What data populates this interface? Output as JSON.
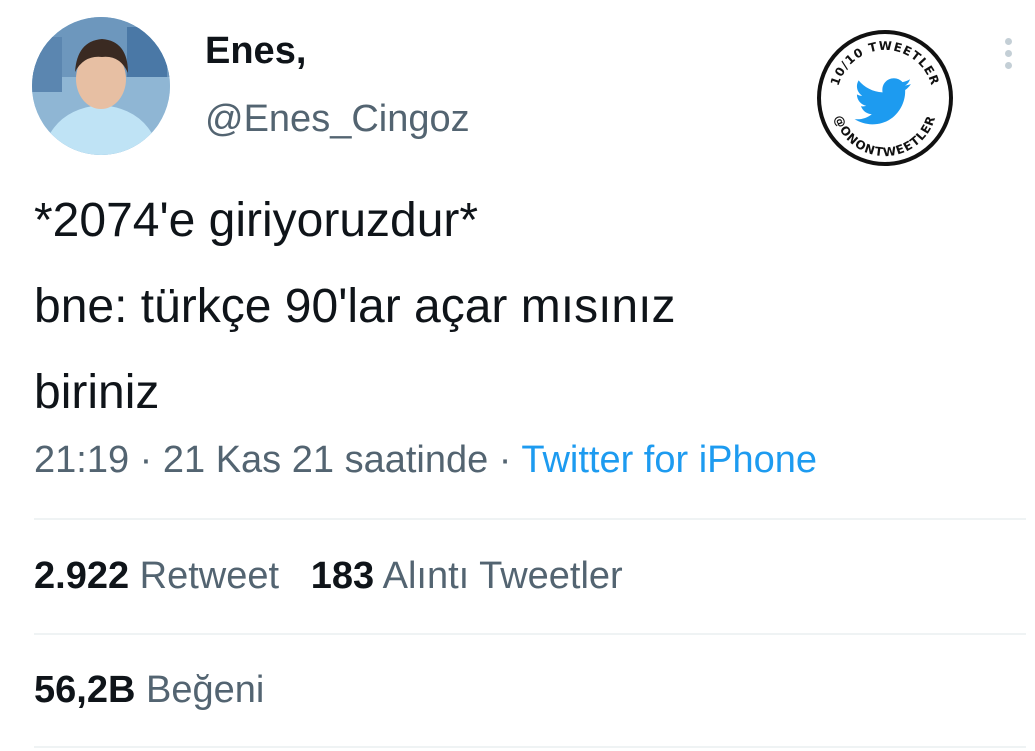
{
  "author": {
    "display_name": "Enes,",
    "handle": "@Enes_Cingoz",
    "avatar": "profile-photo"
  },
  "badge": {
    "top_text": "10/10 TWEETLER",
    "bottom_text": "@ONONTWEETLER",
    "icon": "twitter-bird-icon",
    "color": "#1d9bf0"
  },
  "more_icon": "more-vertical-icon",
  "tweet": {
    "lines": [
      "*2074'e giriyoruzdur*",
      "bne: türkçe 90'lar açar mısınız",
      "biriniz"
    ]
  },
  "meta": {
    "time": "21:19",
    "separator": "·",
    "date": "21 Kas 21 saatinde",
    "source": "Twitter for iPhone"
  },
  "stats": {
    "retweets_count": "2.922",
    "retweets_label": "Retweet",
    "quotes_count": "183",
    "quotes_label": "Alıntı Tweetler",
    "likes_count": "56,2B",
    "likes_label": "Beğeni"
  },
  "colors": {
    "text": "#0f1419",
    "secondary": "#536471",
    "link": "#1d9bf0",
    "divider": "#eff3f4"
  }
}
